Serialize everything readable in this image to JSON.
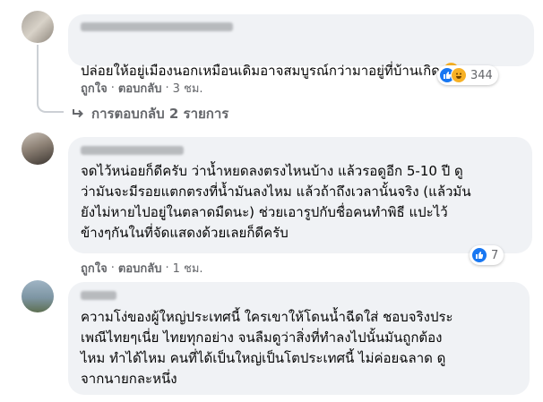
{
  "comments": [
    {
      "text": "ปล่อยให้อยู่เมืองนอกเหมือนเดิมอาจสมบูรณ์กว่ามาอยู่ที่บ้านเกิด",
      "actions": {
        "like": "ถูกใจ",
        "reply": "ตอบกลับ",
        "time": "3 ชม."
      },
      "reactions": {
        "count": "344",
        "icons": [
          "like-icon",
          "haha-icon"
        ]
      },
      "replies_label": "การตอบกลับ 2 รายการ"
    },
    {
      "text": "จดไว้หน่อยก็ดีครับ ว่าน้ำหยดลงตรงไหนบ้าง แล้วรอดูอีก 5-10 ปี ดู\nว่ามันจะมีรอยแตกตรงที่น้ำมันลงไหม แล้วถ้าถึงเวลานั้นจริง (แล้วมัน\nยังไม่หายไปอยู่ในตลาดมืดนะ) ช่วยเอารูปกับชื่อคนทำพิธี แปะไว้\nข้างๆกันในที่จัดแสดงด้วยเลยก็ดีครับ",
      "actions": {
        "like": "ถูกใจ",
        "reply": "ตอบกลับ",
        "time": "1 ชม."
      },
      "reactions": {
        "count": "7",
        "icons": [
          "like-icon"
        ]
      }
    },
    {
      "text": "ความโง่ของผู้ใหญ่ประเทศนี้ ใครเขาให้โดนน้ำฉีดใส่ ชอบจริงประ\nเพณีไทยๆเนี่ย ไทยทุกอย่าง จนลืมดูว่าสิ่งที่ทำลงไปนั้นมันถูกต้อง\nไหม ทำได้ไหม คนที่ได้เป็นใหญ่เป็นโตประเทศนี้ ไม่ค่อยฉลาด ดู\nจากนายกละหนึ่ง"
    }
  ],
  "separator": "·",
  "colors": {
    "bubble": "#f0f2f5",
    "secondary": "#65676b",
    "like": "#1877f2",
    "haha": "#f7b125"
  }
}
